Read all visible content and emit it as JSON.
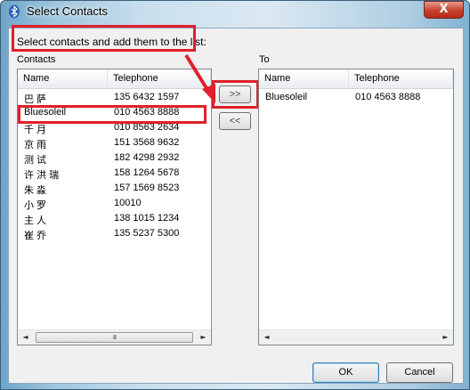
{
  "window": {
    "title": "Select Contacts",
    "close_glyph": "X"
  },
  "instruction": "Select contacts and add them to the list:",
  "contacts": {
    "group_label": "Contacts",
    "columns": [
      "Name",
      "Telephone"
    ],
    "rows": [
      {
        "name": "巴 萨",
        "phone": "135 6432 1597"
      },
      {
        "name": "Bluesoleil",
        "phone": "010 4563 8888"
      },
      {
        "name": "千 月",
        "phone": "010 8563 2634"
      },
      {
        "name": "京 雨",
        "phone": "151 3568 9632"
      },
      {
        "name": "测 试",
        "phone": "182 4298 2932"
      },
      {
        "name": "许 洪 瑞",
        "phone": "158 1264 5678"
      },
      {
        "name": "朱 淼",
        "phone": "157 1569 8523"
      },
      {
        "name": "小 罗",
        "phone": "10010"
      },
      {
        "name": "主 人",
        "phone": "138 1015 1234"
      },
      {
        "name": "崔 乔",
        "phone": "135 5237 5300"
      }
    ]
  },
  "to": {
    "group_label": "To",
    "columns": [
      "Name",
      "Telephone"
    ],
    "rows": [
      {
        "name": "Bluesoleil",
        "phone": "010 4563 8888"
      }
    ]
  },
  "buttons": {
    "add": ">>",
    "remove": "<<",
    "ok": "OK",
    "cancel": "Cancel"
  },
  "scrollbar": {
    "left_arrow": "◄",
    "right_arrow": "►",
    "thumb_grip": "III"
  },
  "colors": {
    "highlight_red": "#e0202a",
    "title_gradient_left": "#6fa5c9",
    "close_button": "#c8412d"
  },
  "icons": {
    "title": "bluetooth-icon",
    "close": "close-icon",
    "annotation_arrow": "red-arrow-icon"
  }
}
